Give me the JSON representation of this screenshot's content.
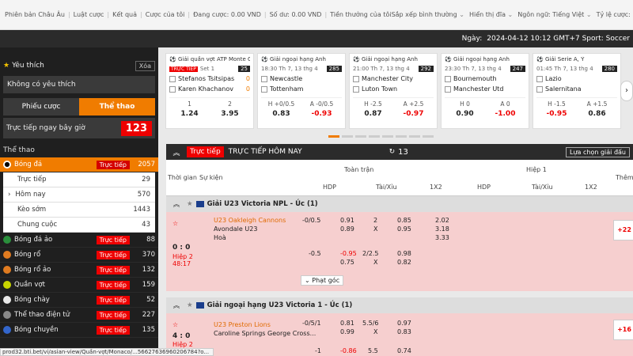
{
  "topbar": {
    "left": [
      "Phiên bản Châu Âu",
      "Luật cược",
      "Kết quả",
      "Cược của tôi",
      "Đang cược: 0.00 VND",
      "Số dư: 0.00 VND",
      "Tiền thưởng của tôi"
    ],
    "sort": "Sắp xếp bình thường",
    "display": "Hiển thị đĩa",
    "language": "Ngôn ngữ: Tiếng Việt",
    "rate": "Tỷ lệ cược: Kiểu Malaysia"
  },
  "infobar": {
    "date_label": "Ngày:",
    "value": "2024-04-12 10:12 GMT+7 Sport: Soccer"
  },
  "sidebar": {
    "fav_title": "Yêu thích",
    "clear": "Xóa",
    "no_fav": "Không có yêu thích",
    "tab_bets": "Phiếu cược",
    "tab_sports": "Thể thao",
    "live_now": "Trực tiếp ngay bây giờ",
    "live_now_count": "123",
    "section": "Thể thao",
    "live_label": "Trực tiếp",
    "football": {
      "name": "Bóng đá",
      "count": "2057"
    },
    "sub": [
      {
        "name": "Trực tiếp",
        "count": "29"
      },
      {
        "name": "Hôm nay",
        "count": "570"
      },
      {
        "name": "Kèo sớm",
        "count": "1443"
      },
      {
        "name": "Chung cuộc",
        "count": "43"
      }
    ],
    "sports": [
      {
        "name": "Bóng đá ảo",
        "count": "88",
        "color": "#2a8f3c"
      },
      {
        "name": "Bóng rổ",
        "count": "370",
        "color": "#e07b20"
      },
      {
        "name": "Bóng rổ ảo",
        "count": "132",
        "color": "#e07b20"
      },
      {
        "name": "Quần vợt",
        "count": "159",
        "color": "#c8d400"
      },
      {
        "name": "Bóng chày",
        "count": "52",
        "color": "#e8e8e8"
      },
      {
        "name": "Thể thao điện tử",
        "count": "227",
        "color": "#888888"
      },
      {
        "name": "Bóng chuyền",
        "count": "135",
        "color": "#3366cc"
      }
    ]
  },
  "cards": [
    {
      "league": "Giải quần vợt ATP Monte Carlo",
      "time": "Set 1",
      "live": "TRỰC TIẾP",
      "badge": "25",
      "home": "Stefanos Tsitsipas",
      "away": "Karen Khachanov",
      "hs": "0",
      "as": "0",
      "l1": "1",
      "l2": "2",
      "v1": "1.24",
      "v2": "3.95"
    },
    {
      "league": "Giải ngoại hạng Anh",
      "time": "18:30 Th 7, 13 thg 4",
      "badge": "285",
      "home": "Newcastle",
      "away": "Tottenham",
      "l1": "H +0/0.5",
      "l2": "A -0/0.5",
      "v1": "0.83",
      "v2": "-0.93"
    },
    {
      "league": "Giải ngoại hạng Anh",
      "time": "21:00 Th 7, 13 thg 4",
      "badge": "292",
      "home": "Manchester City",
      "away": "Luton Town",
      "l1": "H -2.5",
      "l2": "A +2.5",
      "v1": "0.87",
      "v2": "-0.97"
    },
    {
      "league": "Giải ngoại hạng Anh",
      "time": "23:30 Th 7, 13 thg 4",
      "badge": "247",
      "home": "Bournemouth",
      "away": "Manchester Utd",
      "l1": "H 0",
      "l2": "A 0",
      "v1": "0.90",
      "v2": "-1.00"
    },
    {
      "league": "Giải Serie A, Ý",
      "time": "01:45 Th 7, 13 thg 4",
      "badge": "280",
      "home": "Lazio",
      "away": "Salernitana",
      "l1": "H -1.5",
      "l2": "A +1.5",
      "v1": "-0.95",
      "v2": "0.86"
    }
  ],
  "live": {
    "tag": "Trực tiếp",
    "title": "TRỰC TIẾP HÔM NAY",
    "count": "13",
    "choose": "Lựa chọn giải đấu"
  },
  "thead": {
    "time": "Thời gian",
    "event": "Sự kiện",
    "full": "Toàn trận",
    "half": "Hiệp 1",
    "more": "Thêm",
    "hdp": "HDP",
    "ou": "Tài/Xỉu",
    "x12": "1X2"
  },
  "leagues": [
    {
      "name": "Giải U23 Victoria NPL - Úc (1)"
    },
    {
      "name": "Giải ngoại hạng U23 Victoria 1 - Úc (1)"
    }
  ],
  "m1": {
    "score": "0 : 0",
    "period": "Hiệp 2",
    "clock": "48:17",
    "home": "U23 Oakleigh Cannons",
    "away": "Avondale U23",
    "draw": "Hoà",
    "h1": "-0/0.5",
    "o1a": "0.91",
    "o1b": "0.89",
    "t1": "2",
    "tx1": "X",
    "u1a": "0.85",
    "u1b": "0.95",
    "x1": "2.02",
    "x2": "3.18",
    "x3": "3.33",
    "h2": "-0.5",
    "o2a": "-0.95",
    "o2b": "0.75",
    "t2": "2/2.5",
    "tx2": "X",
    "u2a": "0.98",
    "u2b": "0.82",
    "more": "+22",
    "fold": "Phạt góc"
  },
  "m2": {
    "score": "4 : 0",
    "period": "Hiệp 2",
    "home": "U23 Preston Lions",
    "away": "Caroline Springs George Cross...",
    "h1": "-0/5/1",
    "o1a": "0.81",
    "o1b": "0.99",
    "t1": "5.5/6",
    "tx1": "X",
    "u1a": "0.97",
    "u1b": "0.83",
    "h2": "-1",
    "o2a": "-0.86",
    "t2": "5.5",
    "u2a": "0.74",
    "more": "+16"
  },
  "status_url": "prod32.bti.bet/vi/asian-view/Quần-vợt/Monaco/...56627636960206784?o..."
}
